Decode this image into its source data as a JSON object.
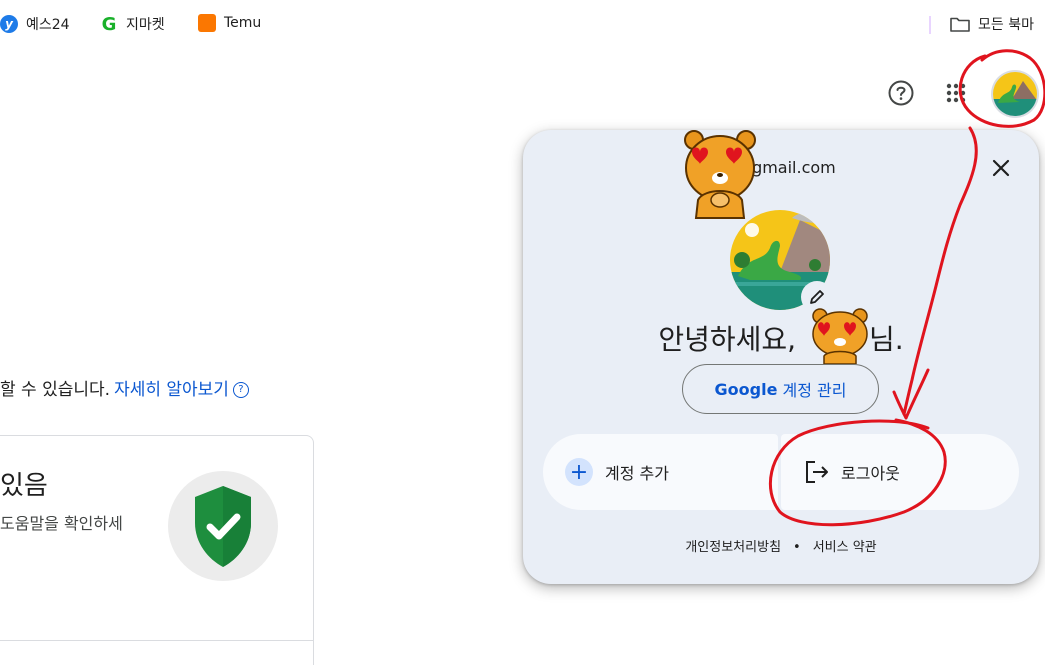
{
  "bookmarks": {
    "items": [
      {
        "label": "예스24",
        "icon": "yes24-icon"
      },
      {
        "label": "지마켓",
        "icon": "gmarket-icon"
      },
      {
        "label": "Temu",
        "icon": "temu-icon"
      }
    ],
    "all_bookmarks": "모든 북마"
  },
  "header": {
    "help_icon": "help-icon",
    "apps_icon": "apps-grid-icon",
    "avatar_icon": "account-avatar"
  },
  "main": {
    "info_text": "할 수 있습니다.",
    "learn_more": "자세히 알아보기",
    "card": {
      "title": "있음",
      "subtitle": "도움말을 확인하세"
    }
  },
  "account_popup": {
    "email": "e@gmail.com",
    "greeting_prefix": "안녕하세요,",
    "greeting_suffix": "님.",
    "manage_google": "Google",
    "manage_account": " 계정 관리",
    "add_account": "계정 추가",
    "logout": "로그아웃",
    "privacy_policy": "개인정보처리방침",
    "separator": "•",
    "terms": "서비스 약관"
  },
  "colors": {
    "link_blue": "#0b57d0",
    "popup_bg": "#e9eef6",
    "annotation_red": "#e0141e",
    "shield_green": "#1e8e3e"
  }
}
